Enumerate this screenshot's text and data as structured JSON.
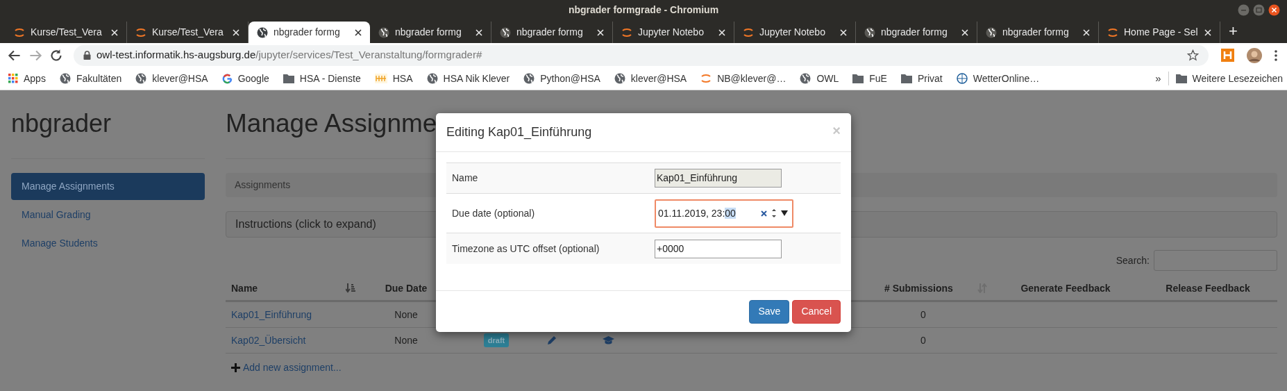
{
  "window": {
    "title": "nbgrader formgrade - Chromium"
  },
  "tabs": [
    {
      "title": "Kurse/Test_Vera",
      "kind": "jupyter",
      "selected": false
    },
    {
      "title": "Kurse/Test_Vera",
      "kind": "jupyter",
      "selected": false
    },
    {
      "title": "nbgrader formg",
      "kind": "globe",
      "selected": true
    },
    {
      "title": "nbgrader formg",
      "kind": "globe_faded",
      "selected": false
    },
    {
      "title": "nbgrader formg",
      "kind": "globe_faded",
      "selected": false
    },
    {
      "title": "Jupyter Notebo",
      "kind": "jupyter",
      "selected": false
    },
    {
      "title": "Jupyter Notebo",
      "kind": "jupyter",
      "selected": false
    },
    {
      "title": "nbgrader formg",
      "kind": "globe_faded",
      "selected": false
    },
    {
      "title": "nbgrader formg",
      "kind": "globe_faded",
      "selected": false
    },
    {
      "title": "Home Page - Sel",
      "kind": "jupyter",
      "selected": false
    }
  ],
  "new_tab": "+",
  "address": {
    "host": "owl-test.informatik.hs-augsburg.de",
    "path": "/jupyter/services/Test_Veranstaltung/formgrader#"
  },
  "bookmarks": [
    {
      "label": "Apps",
      "kind": "apps"
    },
    {
      "label": "Fakultäten",
      "kind": "globe"
    },
    {
      "label": "klever@HSA",
      "kind": "globe"
    },
    {
      "label": "Google",
      "kind": "google"
    },
    {
      "label": "HSA - Dienste",
      "kind": "folder"
    },
    {
      "label": "HSA",
      "kind": "hsa"
    },
    {
      "label": "HSA Nik Klever",
      "kind": "globe"
    },
    {
      "label": "Python@HSA",
      "kind": "globe"
    },
    {
      "label": "klever@HSA",
      "kind": "globe"
    },
    {
      "label": "NB@klever@…",
      "kind": "jupyter"
    },
    {
      "label": "OWL",
      "kind": "globe"
    },
    {
      "label": "FuE",
      "kind": "folder"
    },
    {
      "label": "Privat",
      "kind": "folder"
    },
    {
      "label": "WetterOnline…",
      "kind": "wetter"
    }
  ],
  "bookmarks_more": "»",
  "other_bookmarks": "Weitere Lesezeichen",
  "sidebar": {
    "brand": "nbgrader",
    "items": [
      {
        "label": "Manage Assignments",
        "selected": true
      },
      {
        "label": "Manual Grading",
        "selected": false
      },
      {
        "label": "Manage Students",
        "selected": false
      }
    ]
  },
  "main": {
    "heading": "Manage Assignme",
    "breadcrumb": "Assignments",
    "instructions": "Instructions (click to expand)",
    "search_label": "Search:",
    "table": {
      "columns": [
        {
          "label": "Name",
          "sort": true
        },
        {
          "label": "Due Date",
          "sort": false
        },
        {
          "label": "# Submissions",
          "sort": true
        },
        {
          "label": "Generate Feedback",
          "sort": false
        },
        {
          "label": "Release Feedback",
          "sort": false
        }
      ],
      "rows": [
        {
          "name": "Kap01_Einführung",
          "due_date": "None",
          "submissions": "0"
        },
        {
          "name": "Kap02_Übersicht",
          "due_date": "None",
          "status": "draft",
          "actions": true,
          "submissions": "0"
        }
      ]
    },
    "add_link": "Add new assignment..."
  },
  "dialog": {
    "title": "Editing Kap01_Einführung",
    "close": "×",
    "fields": [
      {
        "label": "Name",
        "value": "Kap01_Einführung",
        "kind": "readonly"
      },
      {
        "label": "Due date (optional)",
        "value": "01.11.2019, 23:",
        "selected_text": "00",
        "kind": "datetime",
        "focused": true
      },
      {
        "label": "Timezone as UTC offset (optional)",
        "value": "+0000",
        "kind": "text"
      }
    ],
    "buttons": [
      {
        "label": "Save",
        "kind": "primary"
      },
      {
        "label": "Cancel",
        "kind": "danger"
      }
    ]
  }
}
